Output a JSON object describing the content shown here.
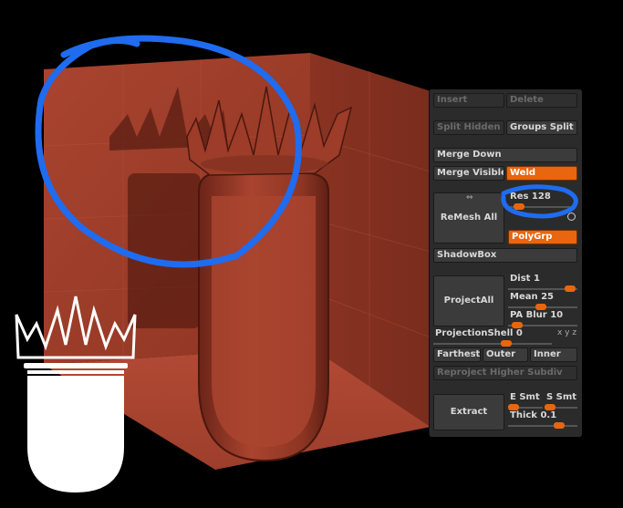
{
  "panel": {
    "insert_label": "Insert",
    "delete_label": "Delete",
    "split_hidden_label": "Split Hidden",
    "groups_split_label": "Groups Split",
    "merge_down_label": "Merge Down",
    "merge_visible_label": "Merge Visible",
    "weld_label": "Weld",
    "remesh_all_label": "ReMesh All",
    "res_label": "Res",
    "res_value": "128",
    "polygrp_label": "PolyGrp",
    "shadowbox_label": "ShadowBox",
    "project_all_label": "ProjectAll",
    "dist_label": "Dist",
    "dist_value": "1",
    "mean_label": "Mean",
    "mean_value": "25",
    "pa_blur_label": "PA Blur",
    "pa_blur_value": "10",
    "projection_shell_label": "ProjectionShell",
    "projection_shell_value": "0",
    "xyz_label": "x y z",
    "farthest_label": "Farthest",
    "outer_label": "Outer",
    "inner_label": "Inner",
    "reproject_label": "Reproject Higher Subdiv",
    "extract_label": "Extract",
    "e_smt_label": "E Smt",
    "s_smt_label": "S Smt",
    "thick_label": "Thick",
    "thick_value": "0.1"
  },
  "colors": {
    "clay": "#9a3a28",
    "accent_orange": "#e8660f",
    "highlight_blue": "#1f6cf0"
  },
  "sliders": {
    "res_level": 0.15,
    "dist_level": 0.92,
    "mean_level": 0.45,
    "pa_blur_level": 0.12,
    "projection_shell_level": 0.0,
    "e_smt_level": 0.1,
    "s_smt_level": 0.6,
    "thick_level": 0.72
  }
}
